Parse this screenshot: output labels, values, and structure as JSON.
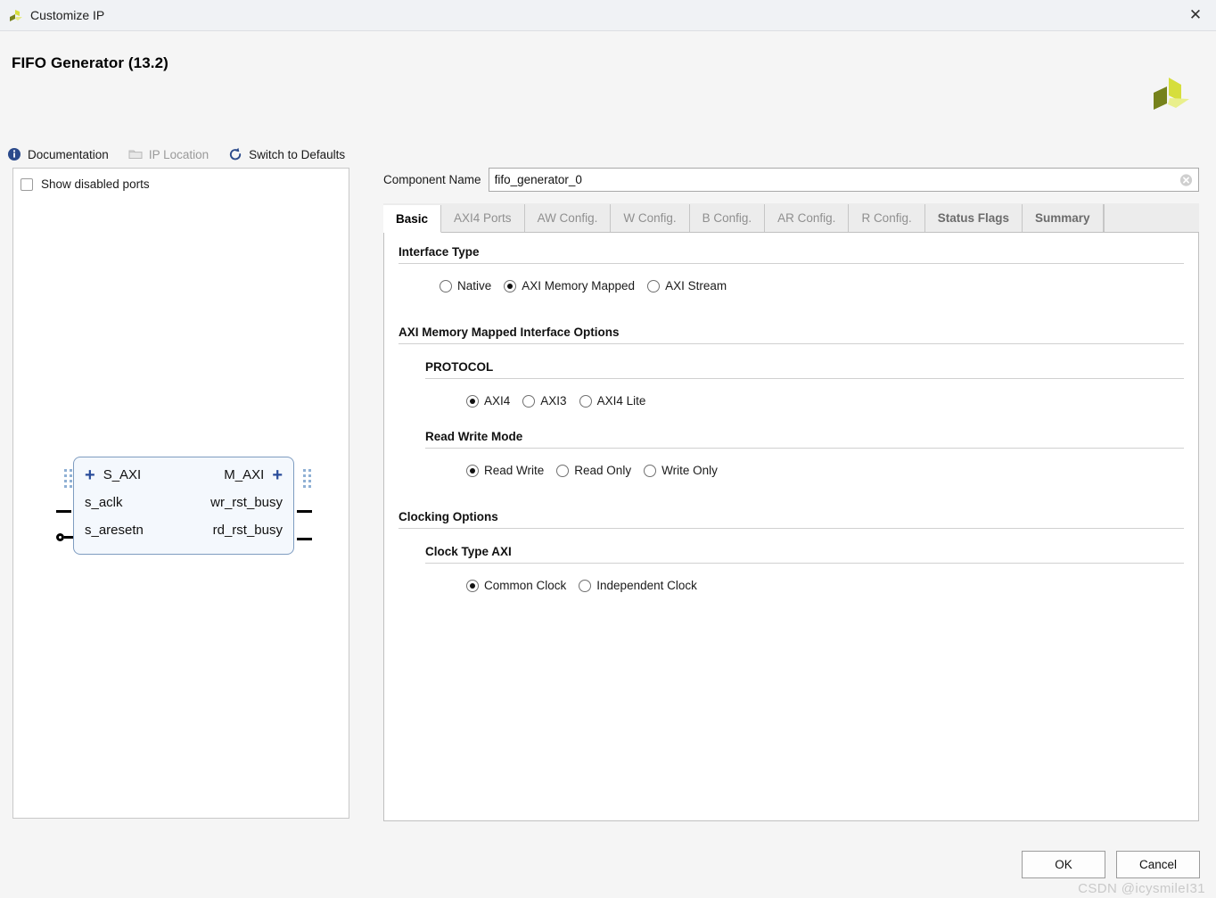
{
  "window": {
    "title": "Customize IP",
    "logo_icon": "xilinx-logo-icon",
    "close_icon": "close-icon"
  },
  "header": {
    "ip_title": "FIFO Generator (13.2)",
    "brand_logo_icon": "xilinx-propeller-icon"
  },
  "toolbar": {
    "items": [
      {
        "label": "Documentation",
        "icon": "info-icon",
        "disabled": false
      },
      {
        "label": "IP Location",
        "icon": "folder-icon",
        "disabled": true
      },
      {
        "label": "Switch to Defaults",
        "icon": "refresh-icon",
        "disabled": false
      }
    ]
  },
  "left_panel": {
    "show_disabled_ports": {
      "label": "Show disabled ports",
      "checked": false
    },
    "symbol": {
      "rows": [
        {
          "left_label": "S_AXI",
          "left_kind": "bus",
          "left_expander": "+",
          "right_label": "M_AXI",
          "right_kind": "bus",
          "right_expander": "+"
        },
        {
          "left_label": "s_aclk",
          "left_kind": "pin",
          "right_label": "wr_rst_busy",
          "right_kind": "pin"
        },
        {
          "left_label": "s_aresetn",
          "left_kind": "pin-inverted",
          "right_label": "rd_rst_busy",
          "right_kind": "pin"
        }
      ]
    }
  },
  "component_name": {
    "label": "Component Name",
    "value": "fifo_generator_0",
    "placeholder": "",
    "clear_icon": "clear-circle-icon"
  },
  "tabs": [
    {
      "label": "Basic",
      "state": "active"
    },
    {
      "label": "AXI4 Ports",
      "state": "disabled"
    },
    {
      "label": "AW Config.",
      "state": "disabled"
    },
    {
      "label": "W Config.",
      "state": "disabled"
    },
    {
      "label": "B Config.",
      "state": "disabled"
    },
    {
      "label": "AR Config.",
      "state": "disabled"
    },
    {
      "label": "R Config.",
      "state": "disabled"
    },
    {
      "label": "Status Flags",
      "state": "strong"
    },
    {
      "label": "Summary",
      "state": "strong"
    }
  ],
  "basic_tab": {
    "interface_type": {
      "title": "Interface Type",
      "options": [
        {
          "label": "Native",
          "selected": false
        },
        {
          "label": "AXI Memory Mapped",
          "selected": true
        },
        {
          "label": "AXI Stream",
          "selected": false
        }
      ]
    },
    "axi_mm_options": {
      "title": "AXI Memory Mapped Interface Options",
      "protocol": {
        "title": "PROTOCOL",
        "options": [
          {
            "label": "AXI4",
            "selected": true
          },
          {
            "label": "AXI3",
            "selected": false
          },
          {
            "label": "AXI4 Lite",
            "selected": false
          }
        ]
      },
      "read_write_mode": {
        "title": "Read Write Mode",
        "options": [
          {
            "label": "Read Write",
            "selected": true
          },
          {
            "label": "Read Only",
            "selected": false
          },
          {
            "label": "Write Only",
            "selected": false
          }
        ]
      }
    },
    "clocking_options": {
      "title": "Clocking Options",
      "clock_type_axi": {
        "title": "Clock Type AXI",
        "options": [
          {
            "label": "Common Clock",
            "selected": true
          },
          {
            "label": "Independent Clock",
            "selected": false
          }
        ]
      }
    }
  },
  "footer": {
    "ok_label": "OK",
    "cancel_label": "Cancel"
  },
  "watermark": "CSDN @icysmileI31",
  "colors": {
    "accent_blue": "#2a4d9b",
    "symbol_border": "#7e9cc0",
    "symbol_fill": "#f4f8fd",
    "brand_yellow": "#d6de3c",
    "brand_olive": "#76821b",
    "window_bg": "#f5f5f5"
  }
}
